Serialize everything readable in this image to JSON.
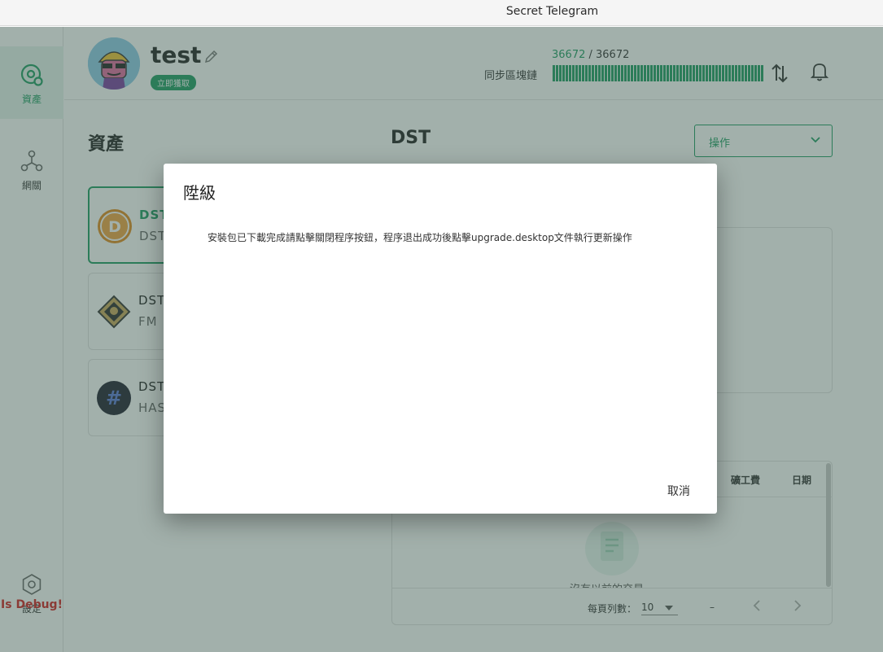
{
  "window": {
    "title": "Secret Telegram"
  },
  "sidebar": {
    "items": [
      {
        "label": "資產",
        "icon": "asset-icon",
        "active": true
      },
      {
        "label": "網關",
        "icon": "network-icon",
        "active": false
      },
      {
        "label": "設定",
        "icon": "settings-icon",
        "active": false
      }
    ],
    "debug_text": "Is Debug!"
  },
  "header": {
    "username": "test",
    "claim_label": "立即獲取",
    "sync_current": "36672",
    "sync_separator": " / ",
    "sync_total": "36672",
    "sync_label": "同步區塊鏈",
    "sync_progress": 1.0
  },
  "main": {
    "section_title": "資產",
    "asset_title": "DST",
    "action_select": "操作",
    "assets": [
      {
        "name": "DST",
        "sub": "DST",
        "icon": "dst-coin-icon",
        "selected": true
      },
      {
        "name": "DST",
        "sub": "FM",
        "icon": "fm-coin-icon",
        "selected": false
      },
      {
        "name": "DST",
        "sub": "HAS",
        "icon": "hash-coin-icon",
        "selected": false
      }
    ],
    "tx_table": {
      "columns": [
        "礦工費",
        "日期"
      ],
      "empty_text": "沒有以前的交易",
      "rows_per_page_label": "每頁列數：",
      "rows_per_page": "10",
      "range": "–"
    }
  },
  "dialog": {
    "title": "陞級",
    "message": "安裝包已下載完成請點擊關閉程序按鈕，程序退出成功後點擊upgrade.desktop文件執行更新操作",
    "cancel_label": "取消"
  },
  "colors": {
    "accent": "#1e9b63",
    "debug": "#d32020",
    "overlay": "rgba(60,90,80,0.48)"
  }
}
